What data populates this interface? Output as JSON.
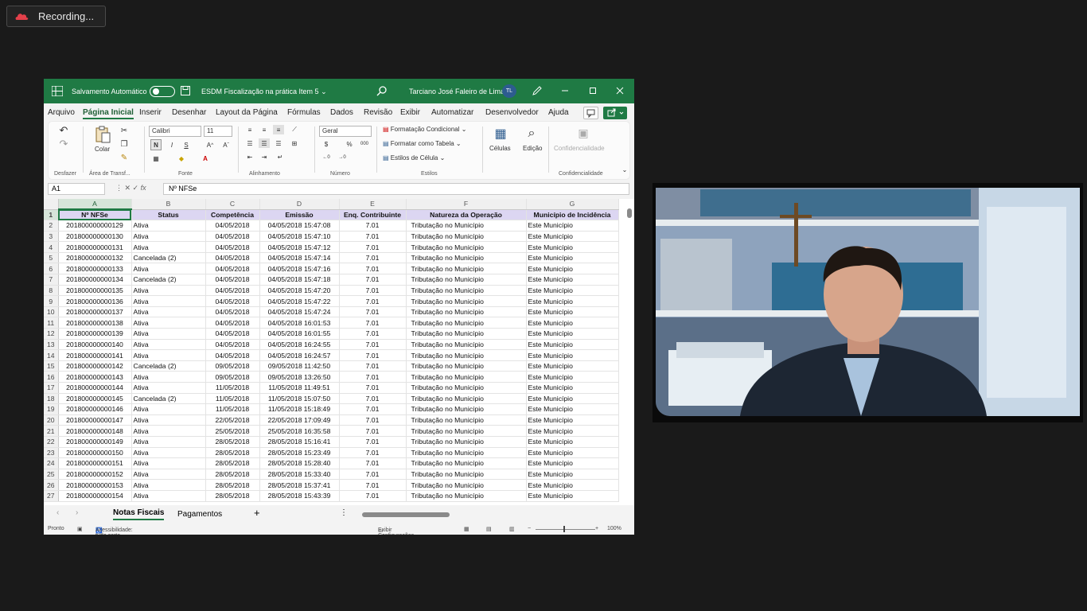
{
  "recording": {
    "label": "Recording..."
  },
  "excel": {
    "autosave_label": "Salvamento Automático",
    "document_title": "ESDM Fiscalização na prática Item 5",
    "user_name": "Tarciano José Faleiro de Lima",
    "user_initials": "TL",
    "menu": [
      "Arquivo",
      "Página Inicial",
      "Inserir",
      "Desenhar",
      "Layout da Página",
      "Fórmulas",
      "Dados",
      "Revisão",
      "Exibir",
      "Automatizar",
      "Desenvolvedor",
      "Ajuda"
    ],
    "active_menu": "Página Inicial",
    "ribbon": {
      "undo_group": "Desfazer",
      "paste": "Colar",
      "clipboard_group": "Área de Transf...",
      "font_name": "Calibri",
      "font_size": "11",
      "bold": "N",
      "italic": "I",
      "underline": "S",
      "font_group": "Fonte",
      "alignment_group": "Alinhamento",
      "number_format": "Geral",
      "number_group": "Número",
      "cond_format": "Formatação Condicional",
      "format_table": "Formatar como Tabela",
      "cell_styles": "Estilos de Célula",
      "styles_group": "Estilos",
      "cells": "Células",
      "editing": "Edição",
      "confidentiality": "Confidencialidade",
      "confidentiality_group": "Confidencialidade"
    },
    "name_box": "A1",
    "formula_value": "Nº NFSe",
    "columns": [
      "A",
      "B",
      "C",
      "D",
      "E",
      "F",
      "G"
    ],
    "headers": [
      "Nº NFSe",
      "Status",
      "Competência",
      "Emissão",
      "Enq. Contribuinte",
      "Natureza da Operação",
      "Município de Incidência"
    ],
    "rows": [
      [
        "201800000000129",
        "Ativa",
        "04/05/2018",
        "04/05/2018 15:47:08",
        "7.01",
        "Tributação no Município",
        "Este Município"
      ],
      [
        "201800000000130",
        "Ativa",
        "04/05/2018",
        "04/05/2018 15:47:10",
        "7.01",
        "Tributação no Município",
        "Este Município"
      ],
      [
        "201800000000131",
        "Ativa",
        "04/05/2018",
        "04/05/2018 15:47:12",
        "7.01",
        "Tributação no Município",
        "Este Município"
      ],
      [
        "201800000000132",
        "Cancelada (2)",
        "04/05/2018",
        "04/05/2018 15:47:14",
        "7.01",
        "Tributação no Município",
        "Este Município"
      ],
      [
        "201800000000133",
        "Ativa",
        "04/05/2018",
        "04/05/2018 15:47:16",
        "7.01",
        "Tributação no Município",
        "Este Município"
      ],
      [
        "201800000000134",
        "Cancelada (2)",
        "04/05/2018",
        "04/05/2018 15:47:18",
        "7.01",
        "Tributação no Município",
        "Este Município"
      ],
      [
        "201800000000135",
        "Ativa",
        "04/05/2018",
        "04/05/2018 15:47:20",
        "7.01",
        "Tributação no Município",
        "Este Município"
      ],
      [
        "201800000000136",
        "Ativa",
        "04/05/2018",
        "04/05/2018 15:47:22",
        "7.01",
        "Tributação no Município",
        "Este Município"
      ],
      [
        "201800000000137",
        "Ativa",
        "04/05/2018",
        "04/05/2018 15:47:24",
        "7.01",
        "Tributação no Município",
        "Este Município"
      ],
      [
        "201800000000138",
        "Ativa",
        "04/05/2018",
        "04/05/2018 16:01:53",
        "7.01",
        "Tributação no Município",
        "Este Município"
      ],
      [
        "201800000000139",
        "Ativa",
        "04/05/2018",
        "04/05/2018 16:01:55",
        "7.01",
        "Tributação no Município",
        "Este Município"
      ],
      [
        "201800000000140",
        "Ativa",
        "04/05/2018",
        "04/05/2018 16:24:55",
        "7.01",
        "Tributação no Município",
        "Este Município"
      ],
      [
        "201800000000141",
        "Ativa",
        "04/05/2018",
        "04/05/2018 16:24:57",
        "7.01",
        "Tributação no Município",
        "Este Município"
      ],
      [
        "201800000000142",
        "Cancelada (2)",
        "09/05/2018",
        "09/05/2018 11:42:50",
        "7.01",
        "Tributação no Município",
        "Este Município"
      ],
      [
        "201800000000143",
        "Ativa",
        "09/05/2018",
        "09/05/2018 13:26:50",
        "7.01",
        "Tributação no Município",
        "Este Município"
      ],
      [
        "201800000000144",
        "Ativa",
        "11/05/2018",
        "11/05/2018 11:49:51",
        "7.01",
        "Tributação no Município",
        "Este Município"
      ],
      [
        "201800000000145",
        "Cancelada (2)",
        "11/05/2018",
        "11/05/2018 15:07:50",
        "7.01",
        "Tributação no Município",
        "Este Município"
      ],
      [
        "201800000000146",
        "Ativa",
        "11/05/2018",
        "11/05/2018 15:18:49",
        "7.01",
        "Tributação no Município",
        "Este Município"
      ],
      [
        "201800000000147",
        "Ativa",
        "22/05/2018",
        "22/05/2018 17:09:49",
        "7.01",
        "Tributação no Município",
        "Este Município"
      ],
      [
        "201800000000148",
        "Ativa",
        "25/05/2018",
        "25/05/2018 16:35:58",
        "7.01",
        "Tributação no Município",
        "Este Município"
      ],
      [
        "201800000000149",
        "Ativa",
        "28/05/2018",
        "28/05/2018 15:16:41",
        "7.01",
        "Tributação no Município",
        "Este Município"
      ],
      [
        "201800000000150",
        "Ativa",
        "28/05/2018",
        "28/05/2018 15:23:49",
        "7.01",
        "Tributação no Município",
        "Este Município"
      ],
      [
        "201800000000151",
        "Ativa",
        "28/05/2018",
        "28/05/2018 15:28:40",
        "7.01",
        "Tributação no Município",
        "Este Município"
      ],
      [
        "201800000000152",
        "Ativa",
        "28/05/2018",
        "28/05/2018 15:33:40",
        "7.01",
        "Tributação no Município",
        "Este Município"
      ],
      [
        "201800000000153",
        "Ativa",
        "28/05/2018",
        "28/05/2018 15:37:41",
        "7.01",
        "Tributação no Município",
        "Este Município"
      ],
      [
        "201800000000154",
        "Ativa",
        "28/05/2018",
        "28/05/2018 15:43:39",
        "7.01",
        "Tributação no Município",
        "Este Município"
      ]
    ],
    "sheets": [
      "Notas Fiscais",
      "Pagamentos"
    ],
    "active_sheet": "Notas Fiscais",
    "status": {
      "ready": "Pronto",
      "accessibility": "Acessibilidade: tudo certo",
      "display_settings": "Exibir Configurações",
      "zoom": "100%"
    }
  },
  "colors": {
    "excel_green": "#1f7a44",
    "header_fill": "#dcd6f2"
  }
}
